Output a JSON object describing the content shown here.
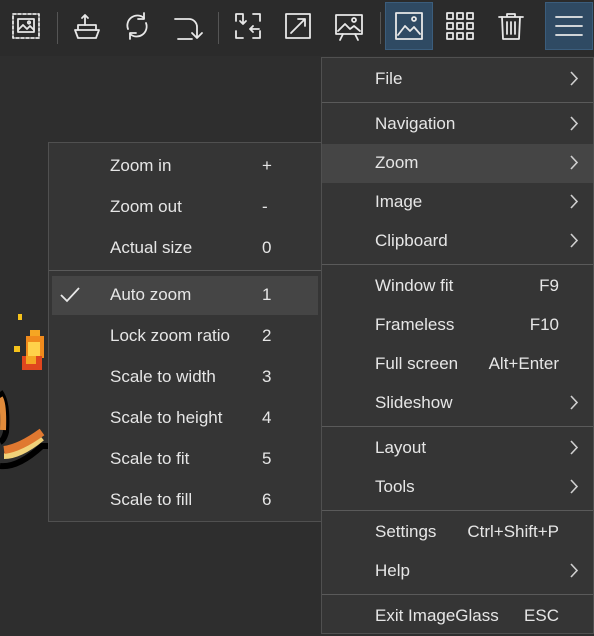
{
  "toolbar": {
    "buttons": [
      {
        "name": "select-region-icon"
      },
      {
        "name": "open-file-icon"
      },
      {
        "name": "rotate-icon"
      },
      {
        "name": "flip-icon"
      },
      {
        "name": "actual-size-icon"
      },
      {
        "name": "window-fit-icon"
      },
      {
        "name": "slideshow-icon"
      },
      {
        "name": "image-view-icon",
        "active": true
      },
      {
        "name": "thumbnail-grid-icon"
      },
      {
        "name": "delete-icon"
      },
      {
        "name": "main-menu-icon",
        "active": true
      }
    ]
  },
  "main_menu": {
    "items": [
      {
        "label": "File",
        "shortcut": "",
        "submenu": true
      },
      {
        "label": "Navigation",
        "shortcut": "",
        "submenu": true
      },
      {
        "label": "Zoom",
        "shortcut": "",
        "submenu": true,
        "highlighted": true
      },
      {
        "label": "Image",
        "shortcut": "",
        "submenu": true
      },
      {
        "label": "Clipboard",
        "shortcut": "",
        "submenu": true
      },
      {
        "label": "Window fit",
        "shortcut": "F9"
      },
      {
        "label": "Frameless",
        "shortcut": "F10"
      },
      {
        "label": "Full screen",
        "shortcut": "Alt+Enter"
      },
      {
        "label": "Slideshow",
        "shortcut": "",
        "submenu": true
      },
      {
        "label": "Layout",
        "shortcut": "",
        "submenu": true
      },
      {
        "label": "Tools",
        "shortcut": "",
        "submenu": true
      },
      {
        "label": "Settings",
        "shortcut": "Ctrl+Shift+P"
      },
      {
        "label": "Help",
        "shortcut": "",
        "submenu": true
      },
      {
        "label": "Exit ImageGlass",
        "shortcut": "ESC"
      }
    ]
  },
  "zoom_menu": {
    "items": [
      {
        "label": "Zoom in",
        "shortcut": "+"
      },
      {
        "label": "Zoom out",
        "shortcut": "-"
      },
      {
        "label": "Actual size",
        "shortcut": "0"
      },
      {
        "label": "Auto zoom",
        "shortcut": "1",
        "checked": true,
        "highlighted": true
      },
      {
        "label": "Lock zoom ratio",
        "shortcut": "2"
      },
      {
        "label": "Scale to width",
        "shortcut": "3"
      },
      {
        "label": "Scale to height",
        "shortcut": "4"
      },
      {
        "label": "Scale to fit",
        "shortcut": "5"
      },
      {
        "label": "Scale to fill",
        "shortcut": "6"
      }
    ]
  },
  "colors": {
    "menu_bg": "#353535",
    "highlight": "#454545",
    "active_button": "#2f4a63"
  }
}
